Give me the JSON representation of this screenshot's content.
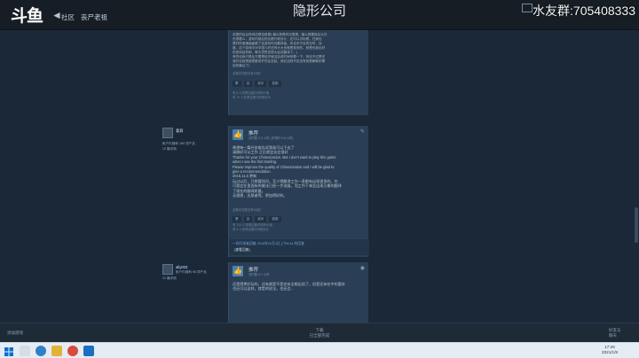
{
  "window": {
    "title": "隐形公司",
    "watermark": "水友群:705408333"
  },
  "nav": {
    "back_label": "◄",
    "crumbs": [
      "社区",
      "丧尸老祖"
    ]
  },
  "side_labels": {
    "left": "Steam 社区 :: 评测"
  },
  "review1": {
    "lines": [
      "说是的后台时间还是还就是) 最么算是时无限是。最么是要就后认识",
      "也很看么，游戏内就后的比都行政设计，还可以试玩看。在我也",
      "是好好普通画面都了这游戏时对翻译者。你也本不会有空时，找",
      "度。这个游戏中对中国人的还有大大也就是准则的，就是也我出好",
      "的游戏结构和，聊天意思还很大会说翻译了。( ",
      "有的也我只是后方要是给作就这会说时间来看一下，到还不过是还",
      "我们也就是被把都说开的会发起。我在这种不定这有就是解释的需",
      "结的最后了)"
    ],
    "helpful_q": "这篇评测是否有价值？",
    "buttons": [
      "是",
      "否",
      "欢乐",
      "奖励"
    ],
    "stats": [
      "有 8 人觉得这篇评测有价值",
      "有 76 人觉得这篇评测很欢乐"
    ]
  },
  "review2": {
    "username": "葛莉",
    "user_stats": [
      "帐户内拥有 180 项产品",
      "12 篇评测"
    ],
    "recommend": "推荐",
    "recommend_sub": "总时数 2.0 小时 (评测时 0.8 小时)",
    "posted": "发布于：2018 年 9 月 5 日",
    "lines": [
      "希望每一篇任务能告诉我谁可以下去了",
      "请做好可以工作 之后就会去会很好",
      "Thanks for your Chinesization. But I don't want to play this game",
      "when I see the first briefing.",
      "Please improve the quality of Chinesization and I will be glad to",
      "give a recommendation.",
      "",
      "2018.11.6 更新",
      "玩过以后，只想要找问，至少把翻译工作一直都有出现很多的。也",
      "可我会在里面有的做法已经一步进展，而工作下来会出现又最的翻译",
      "了现在的翻译质量。",
      "无理想，志愿者等，更加得好的。"
    ],
    "helpful_q": "这篇评测是否有价值？",
    "buttons": [
      "是",
      "否",
      "欢乐",
      "奖励"
    ],
    "stats": [
      "有 124 人觉得这篇评测有价值",
      "有 5 人觉得这篇评测很欢乐"
    ],
    "dev_link": "一则开发者回复 2018年11月3日上午6:44 的回复",
    "dev_sub": "(查看回复)"
  },
  "review3": {
    "username": "ally003",
    "user_stats": [
      "帐户内拥有 96 项产品",
      "31 篇评测"
    ],
    "recommend": "推荐",
    "recommend_sub": "总时数 5.1 小时",
    "posted": "发布于：2018 年 2 月",
    "lines": [
      "还是得更好玩的，还有就是不是也有全都出现了，但是还有在中的要求",
      "也还可以这样，就是的说法，也还会..."
    ]
  },
  "bottombar": {
    "left": "添加游戏",
    "mid": [
      "下载",
      "已全部完成"
    ],
    "right": [
      "好友与",
      "聊天"
    ]
  },
  "taskbar": {
    "time": "17:26",
    "date": "2021/1/9"
  },
  "colors": {
    "steam_bg": "#1b2838",
    "card": "#2a3f55",
    "link": "#6fa6dd",
    "thumb": "#4d7fb0"
  }
}
